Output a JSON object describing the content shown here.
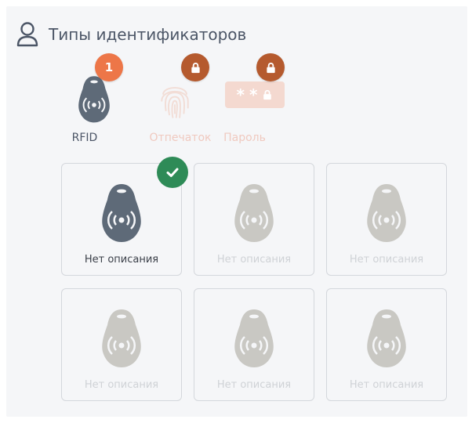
{
  "header": {
    "title": "Типы идентификаторов",
    "icon": "user-icon"
  },
  "identifier_types": [
    {
      "label": "RFID",
      "badge": "1",
      "badge_color": "#ed7648",
      "state": "active",
      "icon": "rfid-tag-icon"
    },
    {
      "label": "Отпечаток",
      "badge": "lock",
      "badge_color": "#b55a2e",
      "state": "locked",
      "icon": "fingerprint-icon"
    },
    {
      "label": "Пароль",
      "badge": "lock",
      "badge_color": "#b55a2e",
      "state": "locked",
      "icon": "password-icon"
    }
  ],
  "keys": [
    {
      "label": "Нет описания",
      "selected": true
    },
    {
      "label": "Нет описания",
      "selected": false
    },
    {
      "label": "Нет описания",
      "selected": false
    },
    {
      "label": "Нет описания",
      "selected": false
    },
    {
      "label": "Нет описания",
      "selected": false
    },
    {
      "label": "Нет описания",
      "selected": false
    }
  ],
  "colors": {
    "active_tag": "#5e6a78",
    "inactive_tag": "#c9c8c3",
    "locked_text": "#f0c9bf",
    "check": "#2e8b57"
  }
}
